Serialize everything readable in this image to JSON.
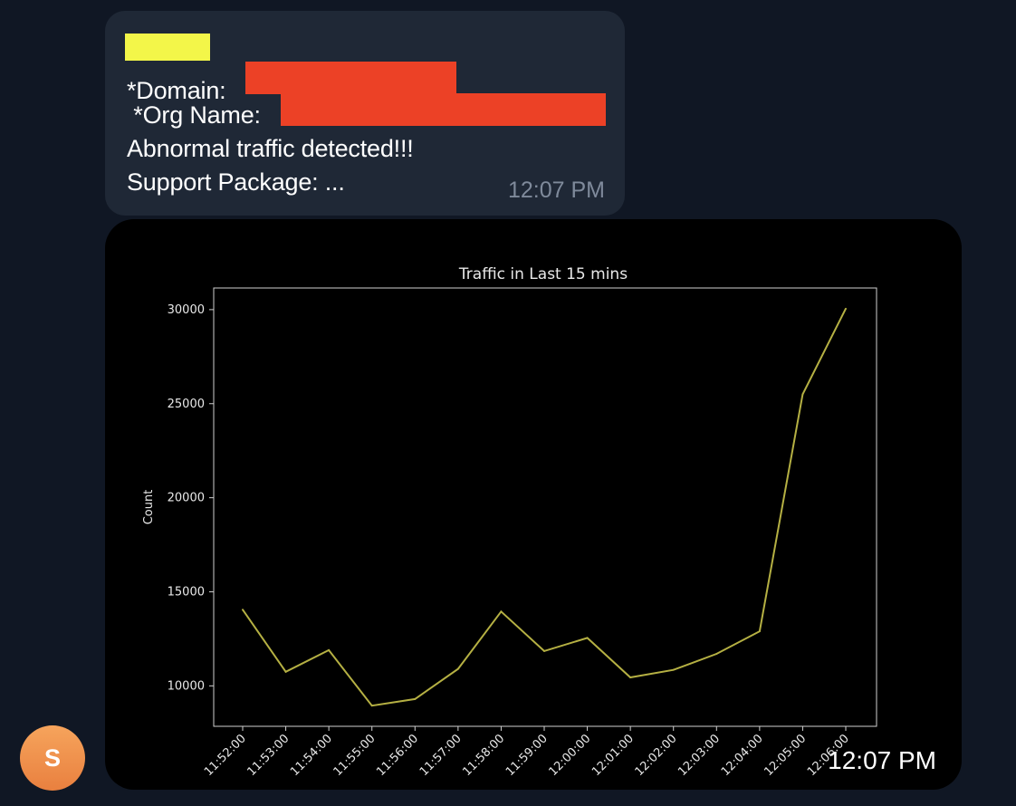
{
  "message": {
    "domain_label": "*Domain:",
    "org_label": " *Org Name:",
    "alert_text": "Abnormal traffic detected!!!",
    "package_text": "Support Package: ...",
    "time": "12:07 PM"
  },
  "image_message": {
    "time": "12:07 PM"
  },
  "avatar": {
    "initial": "S"
  },
  "colors": {
    "redaction_yellow": "#f3f649",
    "redaction_red": "#ec4126",
    "line": "#b5b043",
    "bubble": "#1f2836",
    "background": "#101724"
  },
  "chart_data": {
    "type": "line",
    "title": "Traffic in Last 15 mins",
    "xlabel": "",
    "ylabel": "Count",
    "categories": [
      "11:52:00",
      "11:53:00",
      "11:54:00",
      "11:55:00",
      "11:56:00",
      "11:57:00",
      "11:58:00",
      "11:59:00",
      "12:00:00",
      "12:01:00",
      "12:02:00",
      "12:03:00",
      "12:04:00",
      "12:05:00",
      "12:06:00"
    ],
    "values": [
      14050,
      10750,
      11900,
      8950,
      9300,
      10900,
      13950,
      11850,
      12550,
      10450,
      10850,
      11700,
      12900,
      25500,
      30050
    ],
    "y_ticks": [
      10000,
      15000,
      20000,
      25000,
      30000
    ],
    "ylim": [
      7850,
      31150
    ],
    "grid": false,
    "legend": "none"
  }
}
